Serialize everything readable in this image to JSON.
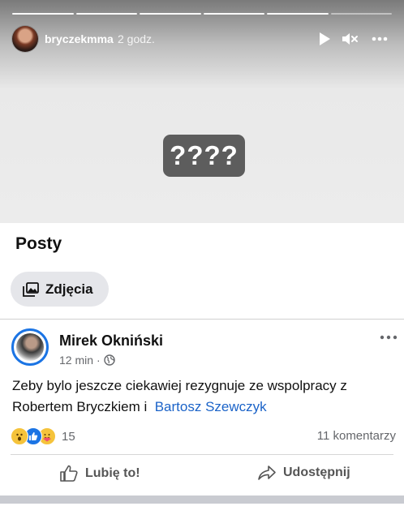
{
  "story": {
    "username": "bryczekmma",
    "time": "2 godz.",
    "sticker_text": "????",
    "progress_segments": 6,
    "progress_current_index": 5
  },
  "facebook": {
    "section_title": "Posty",
    "photos_chip_label": "Zdjęcia",
    "post": {
      "author": "Mirek Okniński",
      "time": "12 min",
      "separator": "·",
      "text": "Zeby bylo jeszcze ciekawiej rezygnuje ze wspolpracy z Robertem Bryczkiem i",
      "tagged": "Bartosz Szewczyk",
      "reactions_count": "15",
      "comments_label": "11 komentarzy",
      "like_label": "Lubię to!",
      "share_label": "Udostępnij"
    }
  },
  "colors": {
    "link": "#1b63c8",
    "avatar_ring": "#1b74e4",
    "chip_bg": "#e5e6ea",
    "sticker_bg": "#5d5d5d"
  }
}
